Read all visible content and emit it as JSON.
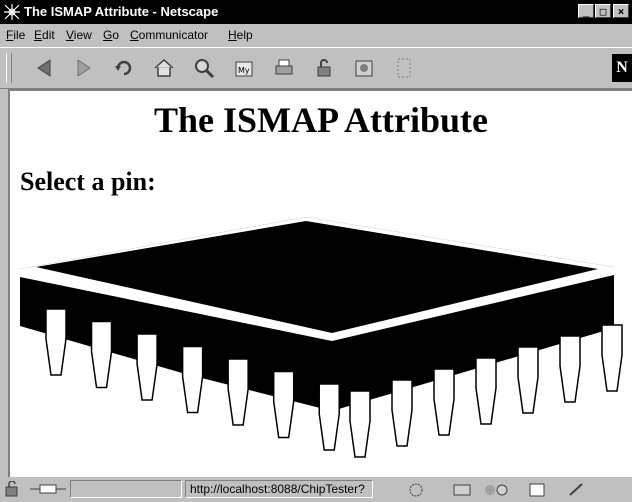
{
  "window": {
    "title": "The ISMAP Attribute - Netscape"
  },
  "menu": [
    "File",
    "Edit",
    "View",
    "Go",
    "Communicator",
    "Help"
  ],
  "toolbar": {
    "buttons": [
      "back",
      "forward",
      "reload",
      "home",
      "search",
      "my-netscape",
      "print",
      "security",
      "shop",
      "stop"
    ]
  },
  "page": {
    "title": "The ISMAP Attribute",
    "subtitle": "Select a pin:",
    "pins_per_side": 14
  },
  "status": {
    "url": "http://localhost:8088/ChipTester?"
  },
  "window_buttons": {
    "minimize": "_",
    "maximize": "□",
    "close": "×"
  }
}
